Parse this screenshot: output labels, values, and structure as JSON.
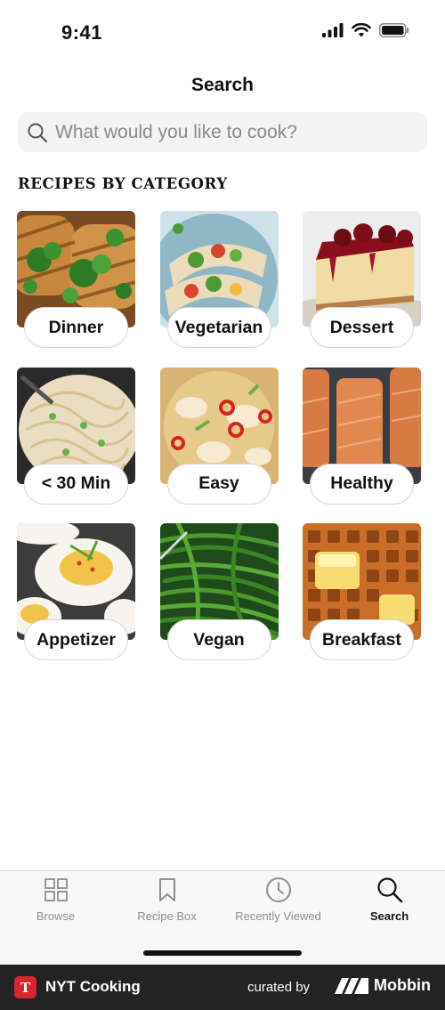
{
  "status_bar": {
    "time": "9:41"
  },
  "header": {
    "title": "Search"
  },
  "search": {
    "placeholder": "What would you like to cook?"
  },
  "section": {
    "title": "RECIPES BY CATEGORY"
  },
  "categories": [
    {
      "label": "Dinner",
      "image": "grilled-chicken-photo"
    },
    {
      "label": "Vegetarian",
      "image": "pita-sandwich-photo"
    },
    {
      "label": "Dessert",
      "image": "cheesecake-photo"
    },
    {
      "label": "< 30 Min",
      "image": "noodles-photo"
    },
    {
      "label": "Easy",
      "image": "dumpling-soup-photo"
    },
    {
      "label": "Healthy",
      "image": "salmon-photo"
    },
    {
      "label": "Appetizer",
      "image": "deviled-eggs-photo"
    },
    {
      "label": "Vegan",
      "image": "green-beans-photo"
    },
    {
      "label": "Breakfast",
      "image": "waffles-photo"
    }
  ],
  "tabs": [
    {
      "label": "Browse",
      "icon": "grid-icon",
      "active": false
    },
    {
      "label": "Recipe Box",
      "icon": "bookmark-icon",
      "active": false
    },
    {
      "label": "Recently Viewed",
      "icon": "clock-icon",
      "active": false
    },
    {
      "label": "Search",
      "icon": "search-icon",
      "active": true
    }
  ],
  "footer": {
    "app_name": "NYT Cooking",
    "logo_letter": "T",
    "curated_by": "curated by",
    "brand": "Mobbin"
  },
  "colors": {
    "accent": "#121212",
    "inactive": "#8e8e8e",
    "search_bg": "#f3f3f3",
    "footer_bg": "#232323",
    "logo_red": "#d8262e"
  }
}
